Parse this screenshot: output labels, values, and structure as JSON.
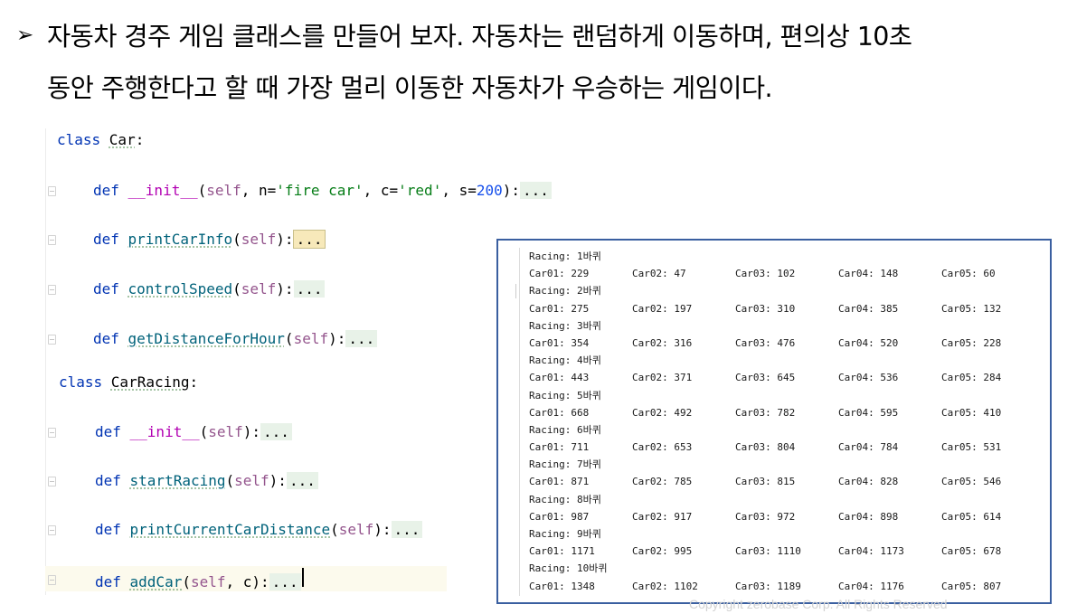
{
  "title": {
    "bullet": "➢",
    "line1": "자동차 경주 게임 클래스를 만들어 보자. 자동차는 랜덤하게 이동하며, 편의상 10초",
    "line2": "동안 주행한다고 할 때 가장 멀리 이동한 자동차가 우승하는 게임이다."
  },
  "code": {
    "lines": [
      {
        "parts": [
          [
            "kw",
            "class "
          ],
          [
            "cls",
            "Car"
          ],
          [
            "plain",
            ":"
          ]
        ]
      },
      {
        "parts": [
          [
            "kw",
            "def "
          ],
          [
            "dunder",
            "__init__"
          ],
          [
            "plain",
            "("
          ],
          [
            "self",
            "self"
          ],
          [
            "plain",
            ", n="
          ],
          [
            "str",
            "'fire car'"
          ],
          [
            "plain",
            ", c="
          ],
          [
            "str",
            "'red'"
          ],
          [
            "plain",
            ", s="
          ],
          [
            "num",
            "200"
          ],
          [
            "plain",
            "):"
          ],
          [
            "dots",
            "..."
          ]
        ]
      },
      {
        "parts": [
          [
            "kw",
            "def "
          ],
          [
            "fn",
            "printCarInfo"
          ],
          [
            "plain",
            "("
          ],
          [
            "self",
            "self"
          ],
          [
            "plain",
            "):"
          ],
          [
            "dotshl",
            "..."
          ]
        ]
      },
      {
        "parts": [
          [
            "kw",
            "def "
          ],
          [
            "fn",
            "controlSpeed"
          ],
          [
            "plain",
            "("
          ],
          [
            "self",
            "self"
          ],
          [
            "plain",
            "):"
          ],
          [
            "dots",
            "..."
          ]
        ]
      },
      {
        "parts": [
          [
            "kw",
            "def "
          ],
          [
            "fn",
            "getDistanceForHour"
          ],
          [
            "plain",
            "("
          ],
          [
            "self",
            "self"
          ],
          [
            "plain",
            "):"
          ],
          [
            "dots",
            "..."
          ]
        ]
      },
      {
        "parts": [
          [
            "kw",
            "class "
          ],
          [
            "cls",
            "CarRacing"
          ],
          [
            "plain",
            ":"
          ]
        ]
      },
      {
        "parts": [
          [
            "kw",
            "def "
          ],
          [
            "dunder",
            "__init__"
          ],
          [
            "plain",
            "("
          ],
          [
            "self",
            "self"
          ],
          [
            "plain",
            "):"
          ],
          [
            "dots",
            "..."
          ]
        ]
      },
      {
        "parts": [
          [
            "kw",
            "def "
          ],
          [
            "fn",
            "startRacing"
          ],
          [
            "plain",
            "("
          ],
          [
            "self",
            "self"
          ],
          [
            "plain",
            "):"
          ],
          [
            "dots",
            "..."
          ]
        ]
      },
      {
        "parts": [
          [
            "kw",
            "def "
          ],
          [
            "fn",
            "printCurrentCarDistance"
          ],
          [
            "plain",
            "("
          ],
          [
            "self",
            "self"
          ],
          [
            "plain",
            "):"
          ],
          [
            "dots",
            "..."
          ]
        ]
      },
      {
        "parts": [
          [
            "kw",
            "def "
          ],
          [
            "fn",
            "addCar"
          ],
          [
            "plain",
            "("
          ],
          [
            "self",
            "self"
          ],
          [
            "plain",
            ", c):"
          ],
          [
            "dots",
            "..."
          ]
        ]
      }
    ]
  },
  "output": {
    "rounds": [
      {
        "label": "Racing: 1바퀴",
        "cars": [
          "Car01: 229",
          "Car02: 47",
          "Car03: 102",
          "Car04: 148",
          "Car05: 60"
        ]
      },
      {
        "label": "Racing: 2바퀴",
        "cars": [
          "Car01: 275",
          "Car02: 197",
          "Car03: 310",
          "Car04: 385",
          "Car05: 132"
        ]
      },
      {
        "label": "Racing: 3바퀴",
        "cars": [
          "Car01: 354",
          "Car02: 316",
          "Car03: 476",
          "Car04: 520",
          "Car05: 228"
        ]
      },
      {
        "label": "Racing: 4바퀴",
        "cars": [
          "Car01: 443",
          "Car02: 371",
          "Car03: 645",
          "Car04: 536",
          "Car05: 284"
        ]
      },
      {
        "label": "Racing: 5바퀴",
        "cars": [
          "Car01: 668",
          "Car02: 492",
          "Car03: 782",
          "Car04: 595",
          "Car05: 410"
        ]
      },
      {
        "label": "Racing: 6바퀴",
        "cars": [
          "Car01: 711",
          "Car02: 653",
          "Car03: 804",
          "Car04: 784",
          "Car05: 531"
        ]
      },
      {
        "label": "Racing: 7바퀴",
        "cars": [
          "Car01: 871",
          "Car02: 785",
          "Car03: 815",
          "Car04: 828",
          "Car05: 546"
        ]
      },
      {
        "label": "Racing: 8바퀴",
        "cars": [
          "Car01: 987",
          "Car02: 917",
          "Car03: 972",
          "Car04: 898",
          "Car05: 614"
        ]
      },
      {
        "label": "Racing: 9바퀴",
        "cars": [
          "Car01: 1171",
          "Car02: 995",
          "Car03: 1110",
          "Car04: 1173",
          "Car05: 678"
        ]
      },
      {
        "label": "Racing: 10바퀴",
        "cars": [
          "Car01: 1348",
          "Car02: 1102",
          "Car03: 1189",
          "Car04: 1176",
          "Car05: 807"
        ]
      }
    ]
  },
  "footer": {
    "copyright": "Copyright zerobase Corp. All Rights Reserved"
  }
}
